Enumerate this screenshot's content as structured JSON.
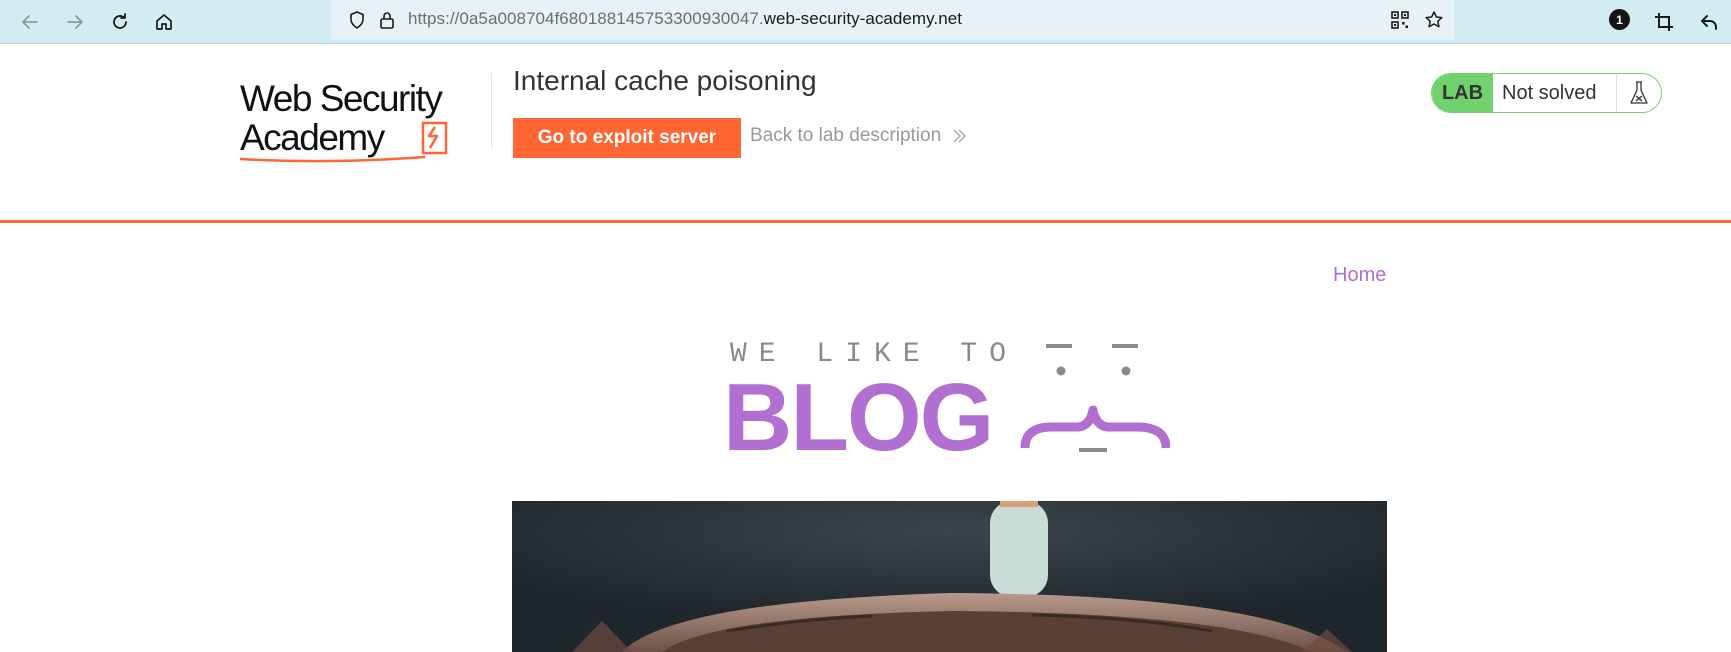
{
  "browser": {
    "url_scheme_path": "https://0a5a008704f680188145753300930047.",
    "url_host": "web-security-academy.net",
    "notification_count": "1"
  },
  "header": {
    "logo_line1": "Web Security",
    "logo_line2": "Academy",
    "lab_title": "Internal cache poisoning",
    "exploit_button": "Go to exploit server",
    "back_link": "Back to lab description",
    "lab_badge": "LAB",
    "lab_status": "Not solved"
  },
  "nav": {
    "home": "Home"
  },
  "banner": {
    "tagline": "WE LIKE TO",
    "word": "BLOG"
  },
  "colors": {
    "accent_orange": "#ff6633",
    "lab_green": "#70d16d",
    "blog_purple": "#b06fd1",
    "browser_bar": "#d2ecf2"
  }
}
